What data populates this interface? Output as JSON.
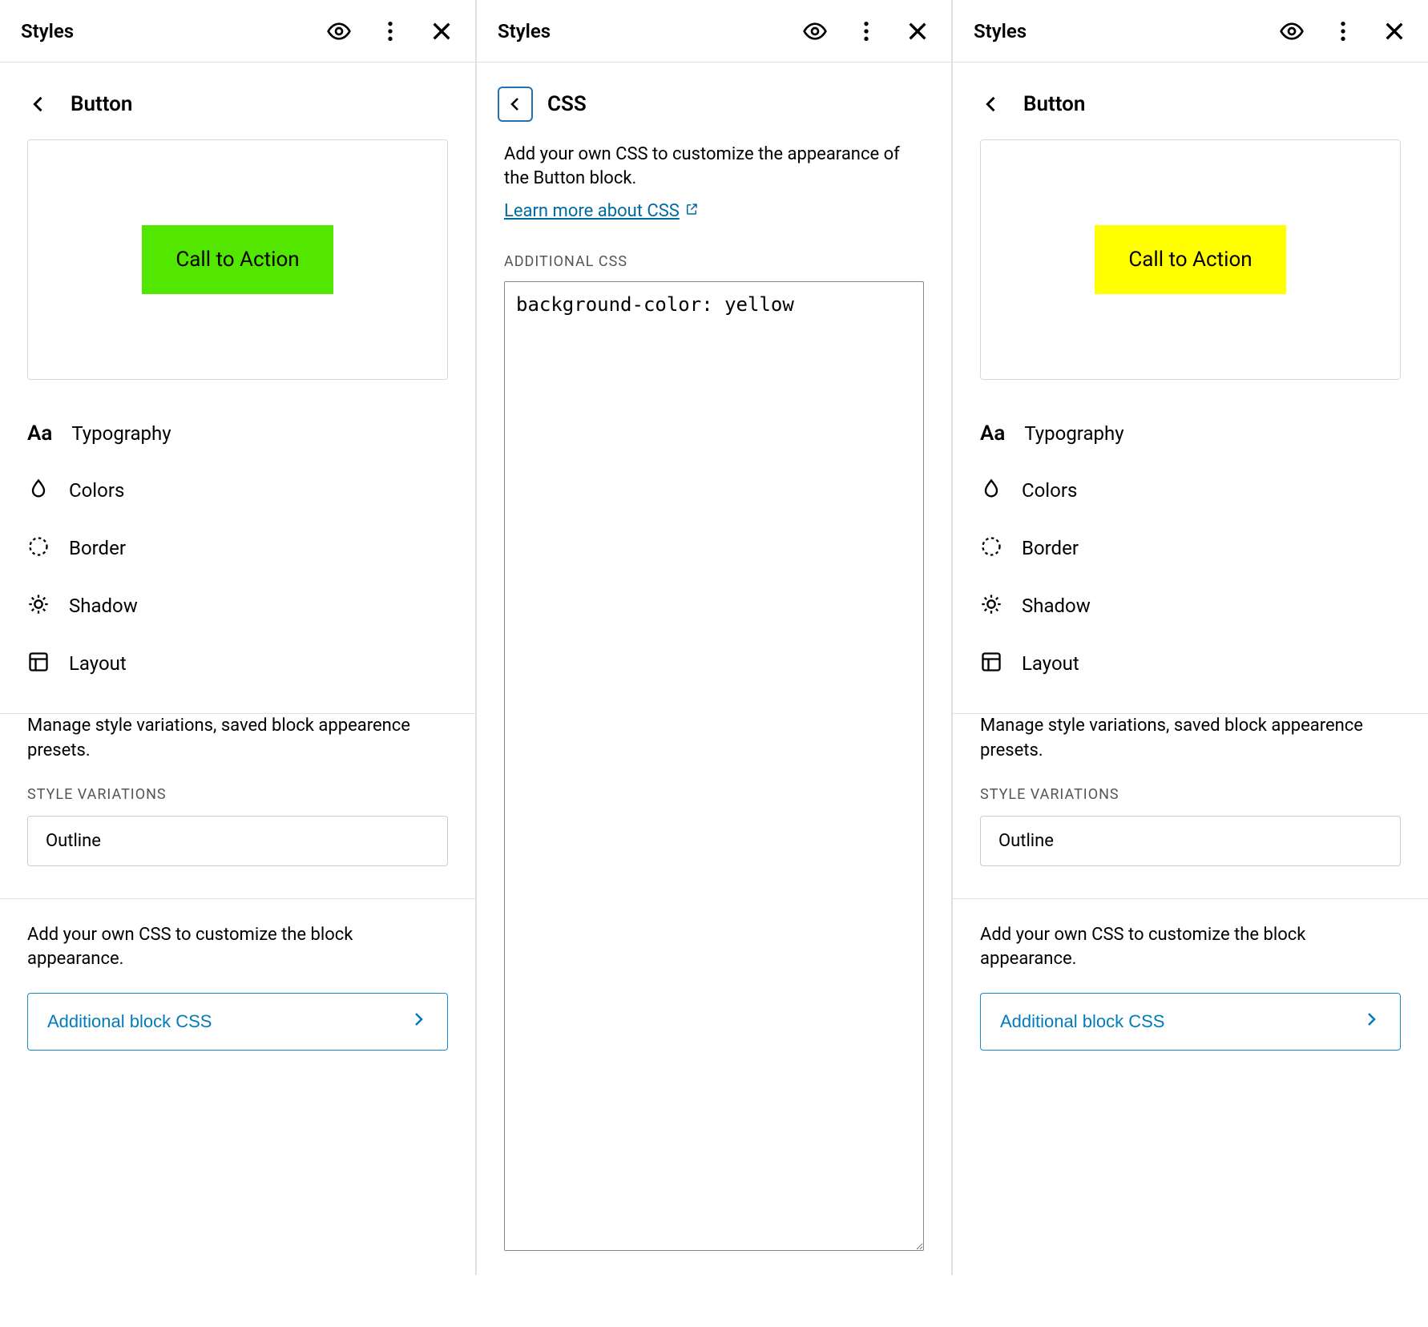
{
  "header_title": "Styles",
  "panel1": {
    "crumb_title": "Button",
    "cta_label": "Call to Action",
    "cta_color": "#52e600",
    "menu": {
      "typography": "Typography",
      "colors": "Colors",
      "border": "Border",
      "shadow": "Shadow",
      "layout": "Layout"
    },
    "var_desc": "Manage style variations, saved block appearence presets.",
    "var_heading": "STYLE VARIATIONS",
    "var_option": "Outline",
    "css_desc": "Add your own CSS to customize the block appearance.",
    "css_button": "Additional block CSS"
  },
  "panel2": {
    "crumb_title": "CSS",
    "description": "Add your own CSS to customize the appearance of the Button block.",
    "learn_link": "Learn more about CSS",
    "additional_label": "ADDITIONAL CSS",
    "css_value": "background-color: yellow"
  },
  "panel3": {
    "crumb_title": "Button",
    "cta_label": "Call to Action",
    "cta_color": "#ffff00",
    "menu": {
      "typography": "Typography",
      "colors": "Colors",
      "border": "Border",
      "shadow": "Shadow",
      "layout": "Layout"
    },
    "var_desc": "Manage style variations, saved block appearence presets.",
    "var_heading": "STYLE VARIATIONS",
    "var_option": "Outline",
    "css_desc": "Add your own CSS to customize the block appearance.",
    "css_button": "Additional block CSS"
  }
}
